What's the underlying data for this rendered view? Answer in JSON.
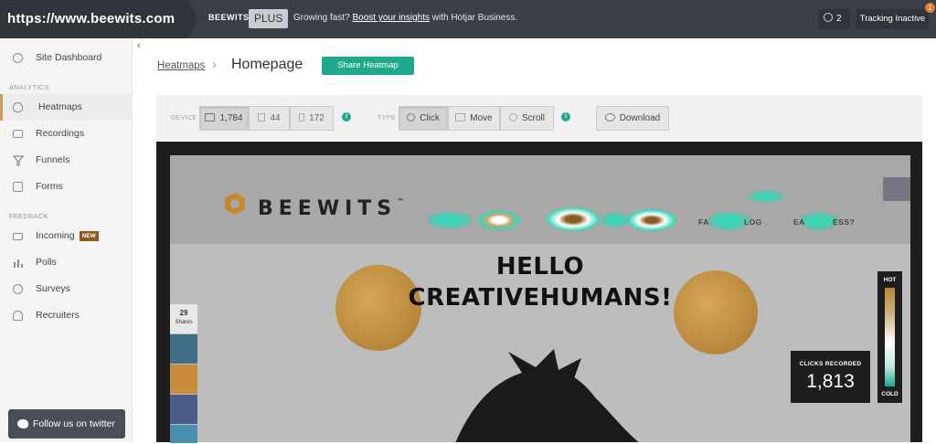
{
  "topbar": {
    "url": "https://www.beewits.com",
    "brand": "BEEWITS",
    "plan": "PLUS",
    "promo_prefix": "Growing fast?",
    "promo_link": "Boost your insights",
    "promo_suffix": "with Hotjar Business.",
    "user_count": "2",
    "tracking_status": "Tracking Inactive",
    "notification_count": "1"
  },
  "sidebar": {
    "collapse_glyph": "‹",
    "site_dashboard": "Site Dashboard",
    "analytics_heading": "ANALYTICS",
    "feedback_heading": "FEEDBACK",
    "items": [
      {
        "label": "Heatmaps",
        "icon": "flame-icon"
      },
      {
        "label": "Recordings",
        "icon": "camera-icon"
      },
      {
        "label": "Funnels",
        "icon": "funnel-icon"
      },
      {
        "label": "Forms",
        "icon": "form-icon"
      },
      {
        "label": "Incoming",
        "icon": "inbox-icon",
        "badge": "NEW"
      },
      {
        "label": "Polls",
        "icon": "poll-icon"
      },
      {
        "label": "Surveys",
        "icon": "survey-icon"
      },
      {
        "label": "Recruiters",
        "icon": "recruiter-icon"
      }
    ],
    "twitter_button": "Follow us on twitter"
  },
  "header": {
    "breadcrumb_link": "Heatmaps",
    "breadcrumb_sep": "›",
    "title": "Homepage",
    "share_button": "Share Heatmap"
  },
  "toolbar": {
    "device_label": "DEVICE",
    "type_label": "TYPE",
    "devices": [
      {
        "name": "desktop",
        "count": "1,784",
        "selected": true
      },
      {
        "name": "tablet",
        "count": "44",
        "selected": false
      },
      {
        "name": "mobile",
        "count": "172",
        "selected": false
      }
    ],
    "types": [
      {
        "label": "Click",
        "selected": true
      },
      {
        "label": "Move",
        "selected": false
      },
      {
        "label": "Scroll",
        "selected": false
      }
    ],
    "download": "Download",
    "info_glyph": "i"
  },
  "heatmap": {
    "site_logo": "BEEWITS",
    "trademark": "™",
    "hero_line1": "HELLO",
    "hero_line2": "CREATIVEHUMANS!",
    "nav_fragments": [
      "FA",
      "LOG",
      "EA",
      "ESS?"
    ],
    "shares_count": "29",
    "shares_label": "Shares",
    "clicks_label": "CLICKS RECORDED",
    "clicks_value": "1,813",
    "legend_hot": "HOT",
    "legend_cold": "COLD"
  },
  "colors": {
    "accent": "#1fa98c",
    "topbar": "#3a3f47",
    "hot": "#b8862f"
  }
}
